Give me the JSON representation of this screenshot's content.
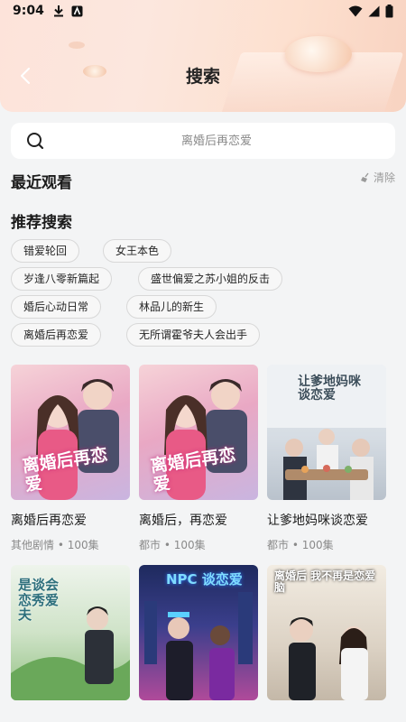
{
  "status_bar": {
    "time": "9:04"
  },
  "header": {
    "title": "搜索"
  },
  "search": {
    "placeholder": "离婚后再恋爱"
  },
  "recent": {
    "title": "最近观看",
    "clear_label": "清除"
  },
  "recommended": {
    "title": "推荐搜索",
    "tags": [
      "错爱轮回",
      "女王本色",
      "岁逢八零新篇起",
      "盛世偏爱之苏小姐的反击",
      "婚后心动日常",
      "林品儿的新生",
      "离婚后再恋爱",
      "无所谓霍爷夫人会出手"
    ]
  },
  "dramas": [
    {
      "title": "离婚后再恋爱",
      "meta": "其他剧情 • 100集",
      "poster_text": "离婚后再恋爱"
    },
    {
      "title": "离婚后，再恋爱",
      "meta": "都市 • 100集",
      "poster_text": "离婚后再恋爱"
    },
    {
      "title": "让爹地妈咪谈恋爱",
      "meta": "都市 • 100集",
      "poster_text": "让爹地妈咪谈恋爱"
    },
    {
      "title": "",
      "meta": "",
      "poster_text": "是谈会恋秀爱夫"
    },
    {
      "title": "",
      "meta": "",
      "poster_text": "NPC 谈恋爱"
    },
    {
      "title": "",
      "meta": "",
      "poster_text": "离婚后 我不再是恋爱脑"
    }
  ],
  "colors": {
    "header_start": "#fde3da",
    "header_end": "#f8d3c1",
    "page_bg": "#f3f4f5"
  }
}
